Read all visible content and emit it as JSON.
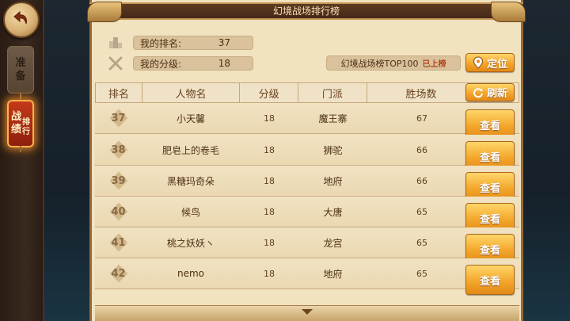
{
  "title": "幻境战场排行榜",
  "sidebar": {
    "prepare_tab": [
      "准",
      "备"
    ],
    "rank_tab_big": [
      "战",
      "绩"
    ],
    "rank_tab_small": [
      "排",
      "行"
    ]
  },
  "my_info": {
    "rank_label": "我的排名:",
    "rank_value": "37",
    "level_label": "我的分级:",
    "level_value": "18"
  },
  "top100": {
    "label": "幻境战场榜TOP100",
    "status": "已上榜"
  },
  "buttons": {
    "locate": "定位",
    "refresh": "刷新",
    "view": "查看"
  },
  "table": {
    "headers": [
      "排名",
      "人物名",
      "分级",
      "门派",
      "胜场数"
    ],
    "rows": [
      {
        "rank": "37",
        "name": "小天馨",
        "level": "18",
        "school": "魔王寨",
        "wins": "67"
      },
      {
        "rank": "38",
        "name": "肥皂上的卷毛",
        "level": "18",
        "school": "狮驼",
        "wins": "66"
      },
      {
        "rank": "39",
        "name": "黑糖玛奇朵",
        "level": "18",
        "school": "地府",
        "wins": "66"
      },
      {
        "rank": "40",
        "name": "候鸟",
        "level": "18",
        "school": "大唐",
        "wins": "65"
      },
      {
        "rank": "41",
        "name": "桃之妖妖ヽ",
        "level": "18",
        "school": "龙宫",
        "wins": "65"
      },
      {
        "rank": "42",
        "name": "nemo",
        "level": "18",
        "school": "地府",
        "wins": "65"
      }
    ]
  },
  "colors": {
    "panel_bg": "#f1e2c0",
    "title_bar": "#4e2f1b",
    "gold_button": "#f3a72b",
    "active_tab": "#c4391a"
  }
}
